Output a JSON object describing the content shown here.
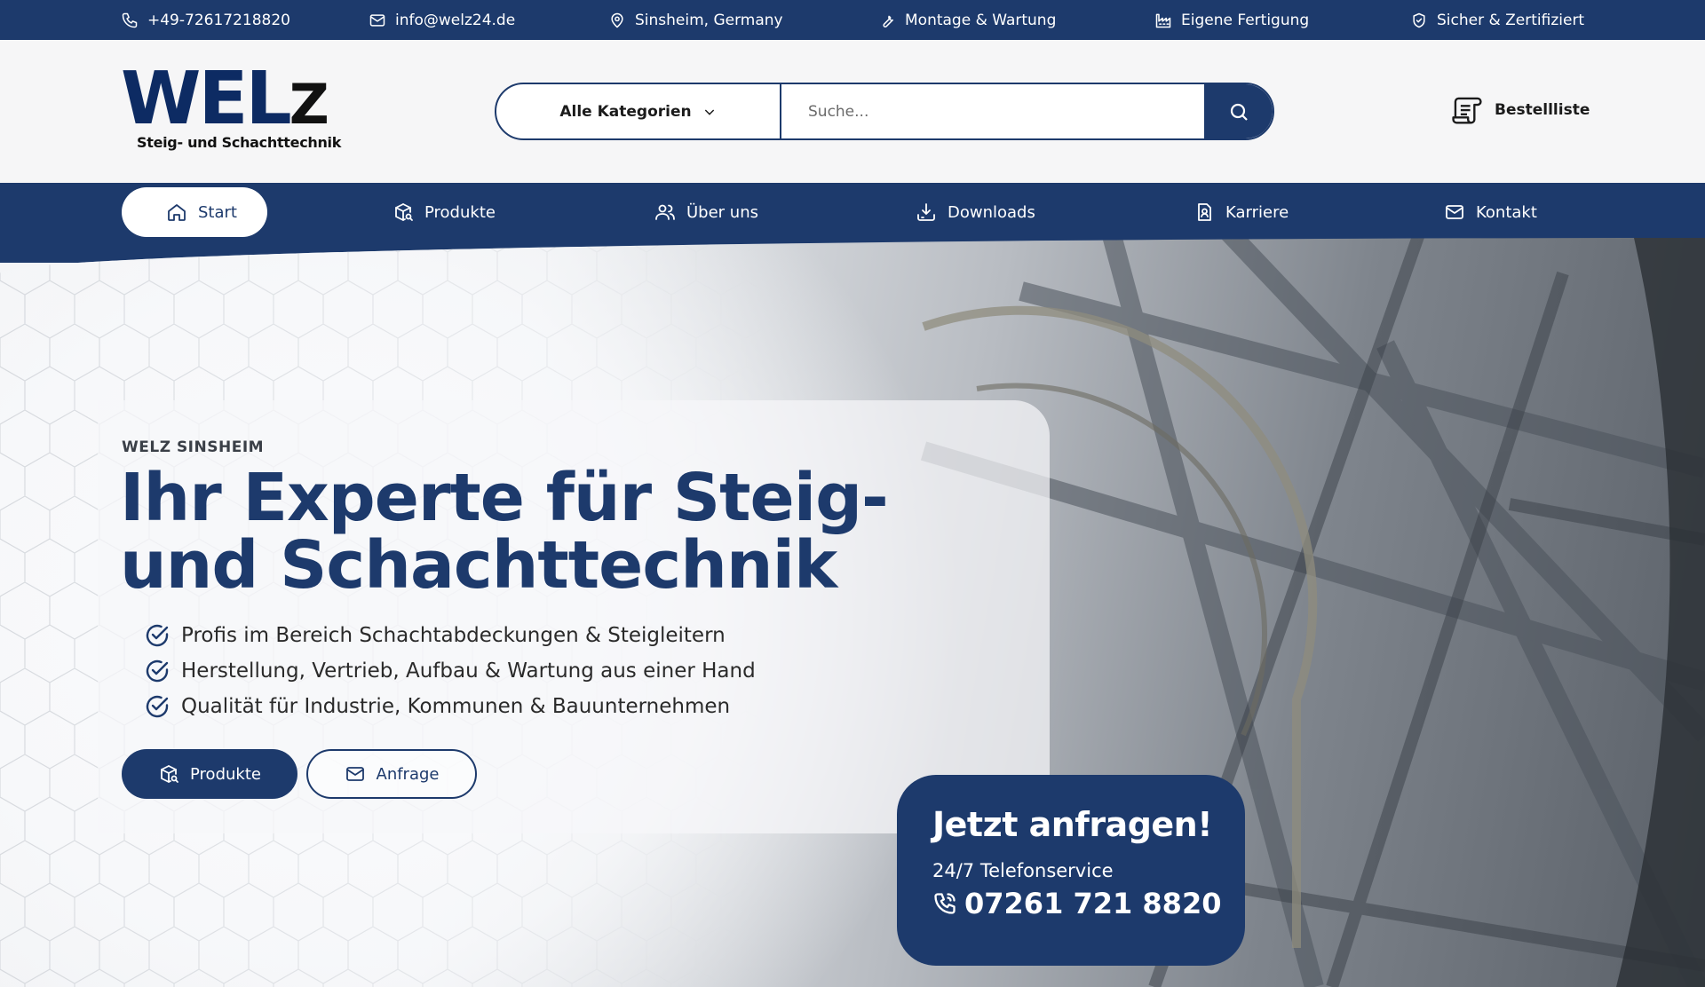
{
  "topbar": {
    "items": [
      {
        "icon": "phone-icon",
        "label": "+49-72617218820"
      },
      {
        "icon": "mail-icon",
        "label": "info@welz24.de"
      },
      {
        "icon": "map-pin-icon",
        "label": "Sinsheim, Germany"
      },
      {
        "icon": "wrench-icon",
        "label": "Montage & Wartung"
      },
      {
        "icon": "factory-icon",
        "label": "Eigene Fertigung"
      },
      {
        "icon": "shield-check-icon",
        "label": "Sicher & Zertifiziert"
      }
    ]
  },
  "header": {
    "logo_word_big": "WEL",
    "logo_word_small": "Z",
    "logo_sub": "Steig- und Schachttechnik",
    "category_label": "Alle Kategorien",
    "search_placeholder": "Suche...",
    "orderlist_label": "Bestellliste"
  },
  "nav": {
    "items": [
      {
        "icon": "home-icon",
        "label": "Start"
      },
      {
        "icon": "product-box-icon",
        "label": "Produkte"
      },
      {
        "icon": "users-icon",
        "label": "Über uns"
      },
      {
        "icon": "download-icon",
        "label": "Downloads"
      },
      {
        "icon": "career-document-icon",
        "label": "Karriere"
      },
      {
        "icon": "mail-icon",
        "label": "Kontakt"
      }
    ]
  },
  "hero": {
    "eyebrow": "WELZ SINSHEIM",
    "headline": "Ihr Experte für Steig- und Schachttechnik",
    "bullets": [
      "Profis im Bereich Schachtabdeckungen & Steigleitern",
      "Herstellung, Vertrieb, Aufbau & Wartung aus einer Hand",
      "Qualität für Industrie, Kommunen & Bauunternehmen"
    ],
    "cta_primary": "Produkte",
    "cta_secondary": "Anfrage"
  },
  "callcard": {
    "title": "Jetzt anfragen!",
    "subtitle": "24/7 Telefonservice",
    "phone": "07261 721 8820"
  },
  "colors": {
    "brand_navy": "#1d3a6c",
    "background": "#f4f5f7"
  }
}
